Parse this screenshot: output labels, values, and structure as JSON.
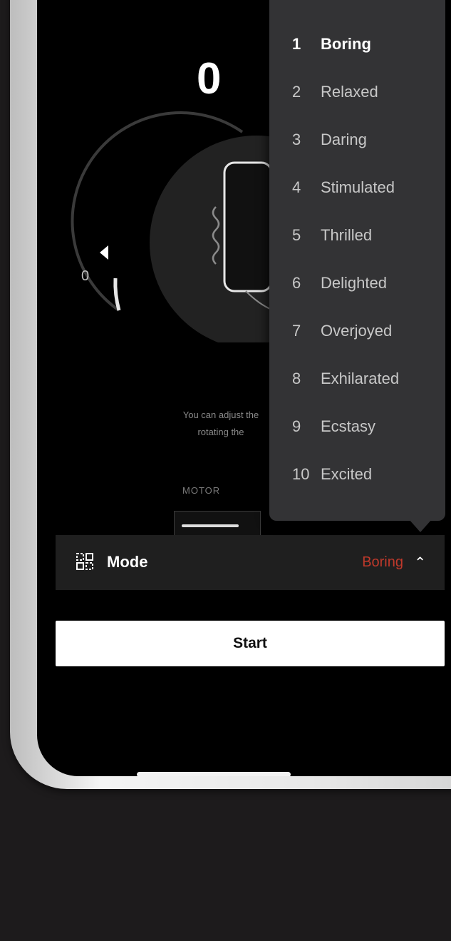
{
  "meter": {
    "value": "0",
    "dial_min": "0"
  },
  "hint": {
    "line1": "You can adjust the",
    "line2": "rotating the"
  },
  "motor": {
    "label": "MOTOR"
  },
  "mode_bar": {
    "label": "Mode",
    "value": "Boring",
    "icon": "mode-grid-icon",
    "chevron": "chevron-up-icon",
    "accent_color": "#c0392b"
  },
  "start_button": {
    "label": "Start"
  },
  "dropdown": {
    "selected_index": 0,
    "items": [
      {
        "num": "1",
        "label": "Boring"
      },
      {
        "num": "2",
        "label": "Relaxed"
      },
      {
        "num": "3",
        "label": "Daring"
      },
      {
        "num": "4",
        "label": "Stimulated"
      },
      {
        "num": "5",
        "label": "Thrilled"
      },
      {
        "num": "6",
        "label": "Delighted"
      },
      {
        "num": "7",
        "label": "Overjoyed"
      },
      {
        "num": "8",
        "label": "Exhilarated"
      },
      {
        "num": "9",
        "label": "Ecstasy"
      },
      {
        "num": "10",
        "label": "Excited"
      }
    ]
  }
}
